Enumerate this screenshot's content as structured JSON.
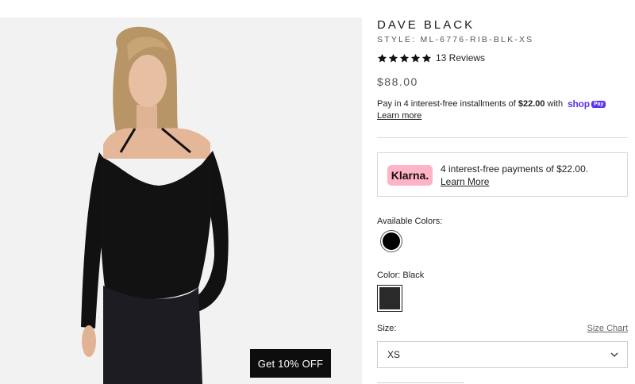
{
  "product": {
    "brand": "DAVE BLACK",
    "style": "STYLE: ML-6776-RIB-BLK-XS",
    "rating": 5,
    "reviews": "13 Reviews",
    "price": "$88.00"
  },
  "shop_pay": {
    "text_before": "Pay in 4 interest-free installments of",
    "amount": "$22.00",
    "text_after": "with",
    "logo_word": "shop",
    "logo_badge": "Pay",
    "learn_more": "Learn more",
    "brand_color": "#5a31f4"
  },
  "klarna": {
    "badge": "Klarna.",
    "text": "4 interest-free payments of $22.00.",
    "learn_more": "Learn More",
    "badge_color": "#ffb3c7"
  },
  "colors": {
    "available_label": "Available Colors:",
    "selected_label": "Color: Black",
    "swatch_color": "#000000"
  },
  "size": {
    "label": "Size:",
    "chart_link": "Size Chart",
    "selected": "XS"
  },
  "promo": {
    "label": "Get 10% OFF"
  }
}
